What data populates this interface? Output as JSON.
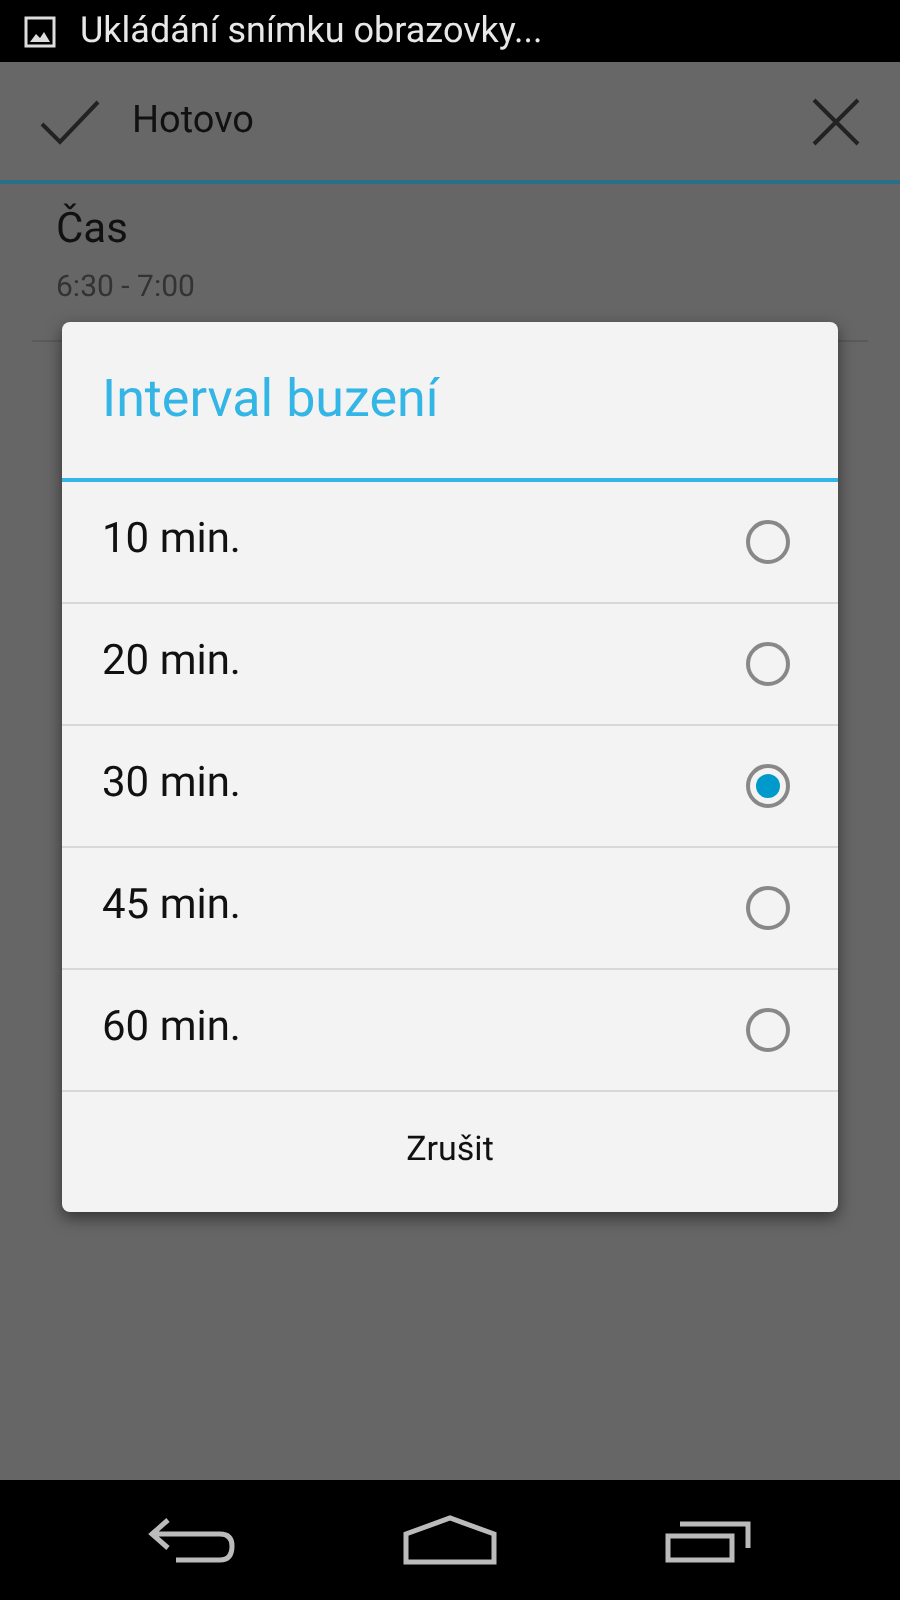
{
  "status_bar": {
    "notification": "Ukládání snímku obrazovky..."
  },
  "action_bar": {
    "done_label": "Hotovo"
  },
  "settings": [
    {
      "title": "Čas",
      "value": "6:30 - 7:00"
    }
  ],
  "dialog": {
    "title": "Interval buzení",
    "options": [
      {
        "label": "10 min.",
        "selected": false
      },
      {
        "label": "20 min.",
        "selected": false
      },
      {
        "label": "30 min.",
        "selected": true
      },
      {
        "label": "45 min.",
        "selected": false
      },
      {
        "label": "60 min.",
        "selected": false
      }
    ],
    "cancel": "Zrušit"
  }
}
